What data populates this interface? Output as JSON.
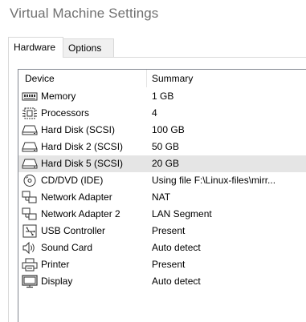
{
  "window": {
    "title": "Virtual Machine Settings"
  },
  "tabs": [
    {
      "label": "Hardware",
      "active": true
    },
    {
      "label": "Options",
      "active": false
    }
  ],
  "device_list": {
    "columns": {
      "device": "Device",
      "summary": "Summary"
    },
    "rows": [
      {
        "device": "Memory",
        "summary": "1 GB",
        "icon": "memory-icon",
        "selected": false
      },
      {
        "device": "Processors",
        "summary": "4",
        "icon": "processor-icon",
        "selected": false
      },
      {
        "device": "Hard Disk (SCSI)",
        "summary": "100 GB",
        "icon": "hard-disk-icon",
        "selected": false
      },
      {
        "device": "Hard Disk 2 (SCSI)",
        "summary": "50 GB",
        "icon": "hard-disk-icon",
        "selected": false
      },
      {
        "device": "Hard Disk 5 (SCSI)",
        "summary": "20 GB",
        "icon": "hard-disk-icon",
        "selected": true
      },
      {
        "device": "CD/DVD (IDE)",
        "summary": "Using file F:\\Linux-files\\mirr...",
        "icon": "cd-dvd-icon",
        "selected": false
      },
      {
        "device": "Network Adapter",
        "summary": "NAT",
        "icon": "network-adapter-icon",
        "selected": false
      },
      {
        "device": "Network Adapter 2",
        "summary": "LAN Segment",
        "icon": "network-adapter-icon",
        "selected": false
      },
      {
        "device": "USB Controller",
        "summary": "Present",
        "icon": "usb-icon",
        "selected": false
      },
      {
        "device": "Sound Card",
        "summary": "Auto detect",
        "icon": "speaker-icon",
        "selected": false
      },
      {
        "device": "Printer",
        "summary": "Present",
        "icon": "printer-icon",
        "selected": false
      },
      {
        "device": "Display",
        "summary": "Auto detect",
        "icon": "display-icon",
        "selected": false
      }
    ]
  },
  "colors": {
    "title_text": "#707070",
    "selected_row": "#e5e5e5",
    "border": "#828790"
  }
}
